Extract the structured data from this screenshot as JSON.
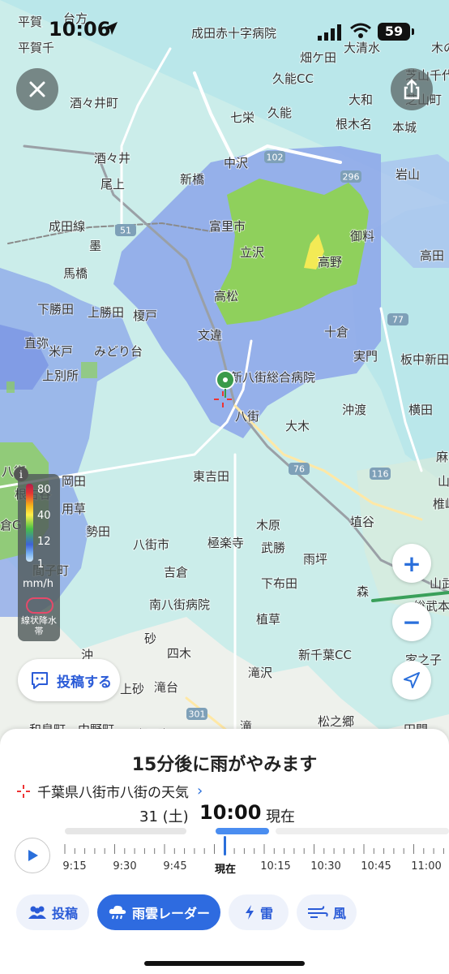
{
  "status": {
    "time": "10:06",
    "battery": "59"
  },
  "map": {
    "labels": [
      {
        "text": "平賀"
      },
      {
        "text": "台方"
      },
      {
        "text": "平賀千"
      },
      {
        "text": "成田赤十字病院"
      },
      {
        "text": "畑ケ田"
      },
      {
        "text": "大清水"
      },
      {
        "text": "木の"
      },
      {
        "text": "芝山千代"
      },
      {
        "text": "久能CC"
      },
      {
        "text": "酒々井町"
      },
      {
        "text": "大和"
      },
      {
        "text": "芝山町"
      },
      {
        "text": "七栄"
      },
      {
        "text": "久能"
      },
      {
        "text": "根木名"
      },
      {
        "text": "本城"
      },
      {
        "text": "酒々井"
      },
      {
        "text": "中沢"
      },
      {
        "text": "岩山"
      },
      {
        "text": "尾上"
      },
      {
        "text": "新橋"
      },
      {
        "text": "成田線"
      },
      {
        "text": "富里市"
      },
      {
        "text": "御料"
      },
      {
        "text": "墨"
      },
      {
        "text": "立沢"
      },
      {
        "text": "高野"
      },
      {
        "text": "高田"
      },
      {
        "text": "馬橋"
      },
      {
        "text": "高松"
      },
      {
        "text": "下勝田"
      },
      {
        "text": "上勝田"
      },
      {
        "text": "榎戸"
      },
      {
        "text": "文違"
      },
      {
        "text": "十倉"
      },
      {
        "text": "直弥"
      },
      {
        "text": "米戸"
      },
      {
        "text": "みどり台"
      },
      {
        "text": "実門"
      },
      {
        "text": "板中新田"
      },
      {
        "text": "上別所"
      },
      {
        "text": "新八街総合病院"
      },
      {
        "text": "八街"
      },
      {
        "text": "沖渡"
      },
      {
        "text": "横田"
      },
      {
        "text": "大木"
      },
      {
        "text": "八街"
      },
      {
        "text": "根古谷"
      },
      {
        "text": "岡田"
      },
      {
        "text": "東吉田"
      },
      {
        "text": "麻"
      },
      {
        "text": "山"
      },
      {
        "text": "用草"
      },
      {
        "text": "椎崎"
      },
      {
        "text": "倉G"
      },
      {
        "text": "勢田"
      },
      {
        "text": "木原"
      },
      {
        "text": "埴谷"
      },
      {
        "text": "八街市"
      },
      {
        "text": "極楽寺"
      },
      {
        "text": "武勝"
      },
      {
        "text": "雨坪"
      },
      {
        "text": "間子町"
      },
      {
        "text": "吉倉"
      },
      {
        "text": "下布田"
      },
      {
        "text": "森"
      },
      {
        "text": "山武"
      },
      {
        "text": "南八街病院"
      },
      {
        "text": "植草"
      },
      {
        "text": "総武本"
      },
      {
        "text": "砂"
      },
      {
        "text": "四木"
      },
      {
        "text": "新千葉CC"
      },
      {
        "text": "家之子"
      },
      {
        "text": "沖"
      },
      {
        "text": "上砂"
      },
      {
        "text": "滝台"
      },
      {
        "text": "滝沢"
      },
      {
        "text": "和泉町"
      },
      {
        "text": "中野町"
      },
      {
        "text": "山田台"
      },
      {
        "text": "滝"
      },
      {
        "text": "松之郷"
      },
      {
        "text": "田間"
      }
    ],
    "roads": [
      "51",
      "102",
      "296",
      "77",
      "76",
      "116",
      "301"
    ]
  },
  "legend": {
    "v80": "80",
    "v40": "40",
    "v12": "12",
    "v1": "1",
    "unit": "mm/h",
    "band_label": "線状降水帯"
  },
  "buttons": {
    "post_label": "投稿する",
    "zoom_in": "+",
    "zoom_out": "−"
  },
  "sheet": {
    "headline": "15分後に雨がやみます",
    "place": "千葉県八街市八街の天気",
    "date": "31 (土)",
    "time": "10:00",
    "now": "現在",
    "timeline": [
      "9:15",
      "9:30",
      "9:45",
      "現在",
      "10:15",
      "10:30",
      "10:45",
      "11:00"
    ]
  },
  "tabs": [
    {
      "label": "投稿",
      "icon": "people-icon",
      "active": false
    },
    {
      "label": "雨雲レーダー",
      "icon": "rain-cloud-icon",
      "active": true
    },
    {
      "label": "雷",
      "icon": "lightning-icon",
      "active": false
    },
    {
      "label": "風",
      "icon": "wind-icon",
      "active": false
    }
  ]
}
